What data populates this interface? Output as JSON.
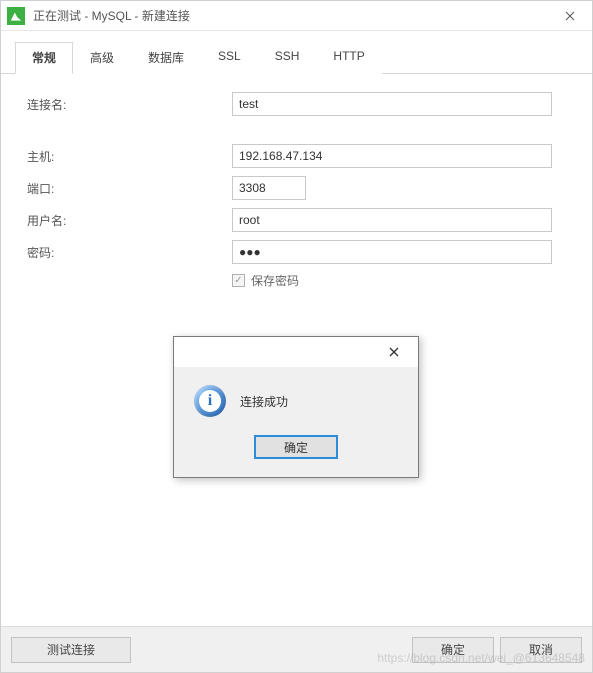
{
  "window": {
    "title": "正在测试 - MySQL - 新建连接"
  },
  "tabs": {
    "general": "常规",
    "advanced": "高级",
    "database": "数据库",
    "ssl": "SSL",
    "ssh": "SSH",
    "http": "HTTP"
  },
  "form": {
    "connection_name_label": "连接名:",
    "connection_name_value": "test",
    "host_label": "主机:",
    "host_value": "192.168.47.134",
    "port_label": "端口:",
    "port_value": "3308",
    "user_label": "用户名:",
    "user_value": "root",
    "password_label": "密码:",
    "password_value": "●●●",
    "save_password_label": "保存密码"
  },
  "footer": {
    "test_connection": "测试连接",
    "ok": "确定",
    "cancel": "取消"
  },
  "modal": {
    "message": "连接成功",
    "ok": "确定"
  },
  "watermark": "https://blog.csdn.net/wei_@613648548"
}
